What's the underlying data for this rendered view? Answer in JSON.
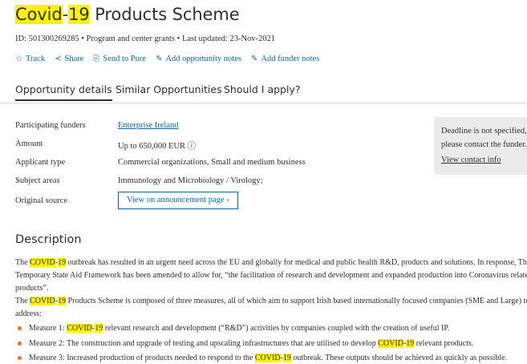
{
  "title": {
    "hl": "Covid",
    "sep": "-",
    "num": "19",
    "rest": " Products Scheme"
  },
  "meta": "ID: 501300269285 • Program and center grants • Last updated: 23-Nov-2021",
  "actions": [
    {
      "icon": "star-icon",
      "glyph": "☆",
      "label": "Track"
    },
    {
      "icon": "share-icon",
      "glyph": "≺",
      "label": "Share"
    },
    {
      "icon": "send-icon",
      "glyph": "⎘",
      "label": "Send to Pure"
    },
    {
      "icon": "note-icon",
      "glyph": "✎",
      "label": "Add opportunity notes"
    },
    {
      "icon": "note-icon",
      "glyph": "✎",
      "label": "Add funder notes"
    }
  ],
  "tabs": [
    "Opportunity details",
    "Similar Opportunities",
    "Should I apply?"
  ],
  "details": {
    "funders": {
      "label": "Participating funders",
      "value": "Enterprise Ireland"
    },
    "amount": {
      "label": "Amount",
      "value": "Up to 650,000 EUR ⓘ"
    },
    "applicant": {
      "label": "Applicant type",
      "value": "Commercial organizations, Small and medium business"
    },
    "subject": {
      "label": "Subject areas",
      "value": "Immunology and Microbiology / Virology;"
    },
    "source": {
      "label": "Original source",
      "button": "View on announcement page ›"
    }
  },
  "deadline": {
    "text": "Deadline is not specified, please contact the funder.",
    "contact": "View contact info"
  },
  "description": {
    "heading": "Description",
    "p1": {
      "pre": "The ",
      "hl": "COVID",
      "dash": "-",
      "hl2": "19",
      "line1_rest": " outbreak has resulted in an urgent need across the EU and globally for medical and public health R&D, products and solutions. In response, The EU",
      "line2": "Temporary State Aid Framework has been amended to allow for, “the facilitation of research and development and expanded production into Coronavirus related",
      "line3": "products”."
    },
    "p2": {
      "pre": "The ",
      "hl": "COVID",
      "dash": "-",
      "hl2": "19",
      "line1_rest": " Products Scheme is composed of three measures, all of which aim to support Irish based internationally focused companies (SME and Large) to",
      "line2": "address:"
    },
    "bullets": [
      {
        "pre": "Measure 1: ",
        "hl": "COVID",
        "dash": "-",
        "hl2": "19",
        "post": " relevant research and development (“R&D”) activities by companies coupled with the creation of useful IP."
      },
      {
        "pre": "Measure 2: The construction and upgrade of testing and upscaling infrastructures that are utilised to develop ",
        "hl": "COVID",
        "dash": "-",
        "hl2": "19",
        "post": " relevant products."
      },
      {
        "pre": "Measure 3: Increased production of products needed to respond to the ",
        "hl": "COVID",
        "dash": "-",
        "hl2": "19",
        "post": " outbreak. These outputs should be achieved as quickly as possible."
      }
    ]
  },
  "colors": {
    "highlight": "#fff200",
    "link": "#0b64a8",
    "bullet": "#e9711c",
    "deadline_bg": "#ebebeb"
  }
}
